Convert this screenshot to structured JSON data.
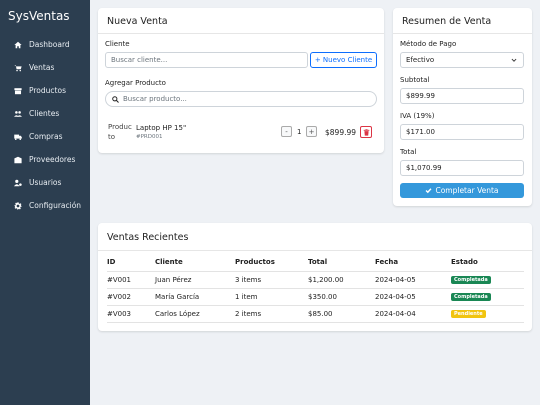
{
  "app": {
    "brand": "SysVentas"
  },
  "sidebar": {
    "items": [
      {
        "label": "Dashboard",
        "icon": "home-icon"
      },
      {
        "label": "Ventas",
        "icon": "cart-icon"
      },
      {
        "label": "Productos",
        "icon": "box-icon"
      },
      {
        "label": "Clientes",
        "icon": "users-icon"
      },
      {
        "label": "Compras",
        "icon": "truck-icon"
      },
      {
        "label": "Proveedores",
        "icon": "warehouse-icon"
      },
      {
        "label": "Usuarios",
        "icon": "user-cog-icon"
      },
      {
        "label": "Configuración",
        "icon": "gear-icon"
      }
    ]
  },
  "nueva_venta": {
    "title": "Nueva Venta",
    "cliente_label": "Cliente",
    "cliente_placeholder": "Buscar cliente...",
    "nuevo_cliente_button": "+ Nuevo Cliente",
    "agregar_label": "Agregar Producto",
    "producto_placeholder": "Buscar producto...",
    "item": {
      "image_alt": "Producto",
      "name": "Laptop HP 15\"",
      "sku": "#PRD001",
      "qty": "1",
      "minus": "-",
      "plus": "+",
      "price": "$899.99"
    }
  },
  "resumen": {
    "title": "Resumen de Venta",
    "metodo_label": "Método de Pago",
    "metodo_value": "Efectivo",
    "subtotal_label": "Subtotal",
    "subtotal_value": "$899.99",
    "iva_label": "IVA (19%)",
    "iva_value": "$171.00",
    "total_label": "Total",
    "total_value": "$1,070.99",
    "complete_button": "Completar Venta"
  },
  "recientes": {
    "title": "Ventas Recientes",
    "headers": [
      "ID",
      "Cliente",
      "Productos",
      "Total",
      "Fecha",
      "Estado"
    ],
    "rows": [
      {
        "id": "#V001",
        "cliente": "Juan Pérez",
        "productos": "3 items",
        "total": "$1,200.00",
        "fecha": "2024-04-05",
        "estado": "Completada",
        "estado_color": "#198754"
      },
      {
        "id": "#V002",
        "cliente": "María García",
        "productos": "1 item",
        "total": "$350.00",
        "fecha": "2024-04-05",
        "estado": "Completada",
        "estado_color": "#198754"
      },
      {
        "id": "#V003",
        "cliente": "Carlos López",
        "productos": "2 items",
        "total": "$85.00",
        "fecha": "2024-04-04",
        "estado": "Pendiente",
        "estado_color": "#f1c40f"
      }
    ]
  },
  "colors": {
    "sidebar": "#2c3e50",
    "primary": "#3498db",
    "success": "#198754",
    "warning": "#f1c40f",
    "danger": "#dc3545"
  }
}
